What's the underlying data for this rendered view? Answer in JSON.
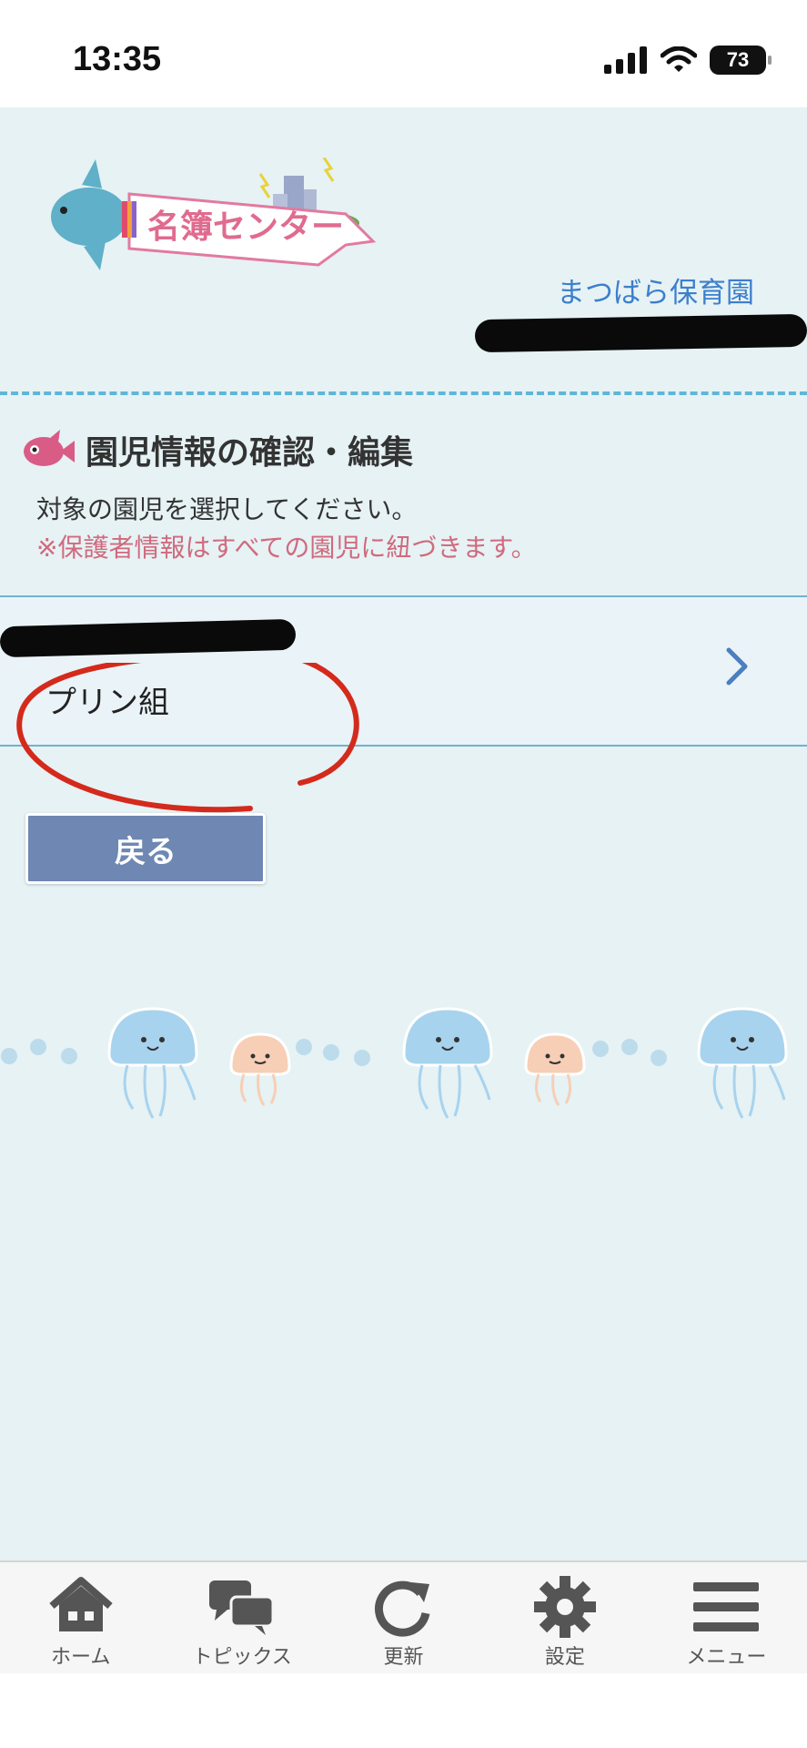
{
  "status": {
    "time": "13:35",
    "battery": "73"
  },
  "header": {
    "logo_text": "名簿センター",
    "school_name": "まつばら保育園"
  },
  "section": {
    "title": "園児情報の確認・編集",
    "instruction": "対象の園児を選択してください。",
    "note": "※保護者情報はすべての園児に紐づきます。"
  },
  "child": {
    "class_name": "プリン組"
  },
  "back_label": "戻る",
  "tabs": [
    {
      "label": "ホーム",
      "icon": "home-icon"
    },
    {
      "label": "トピックス",
      "icon": "chat-bubbles-icon"
    },
    {
      "label": "更新",
      "icon": "refresh-icon"
    },
    {
      "label": "設定",
      "icon": "gear-icon"
    },
    {
      "label": "メニュー",
      "icon": "menu-icon"
    }
  ],
  "colors": {
    "background": "#e6f2f4",
    "accent_blue": "#3c7fcc",
    "note_pink": "#d06a7e",
    "button": "#6f87b3",
    "annotation_red": "#d42a1c"
  }
}
